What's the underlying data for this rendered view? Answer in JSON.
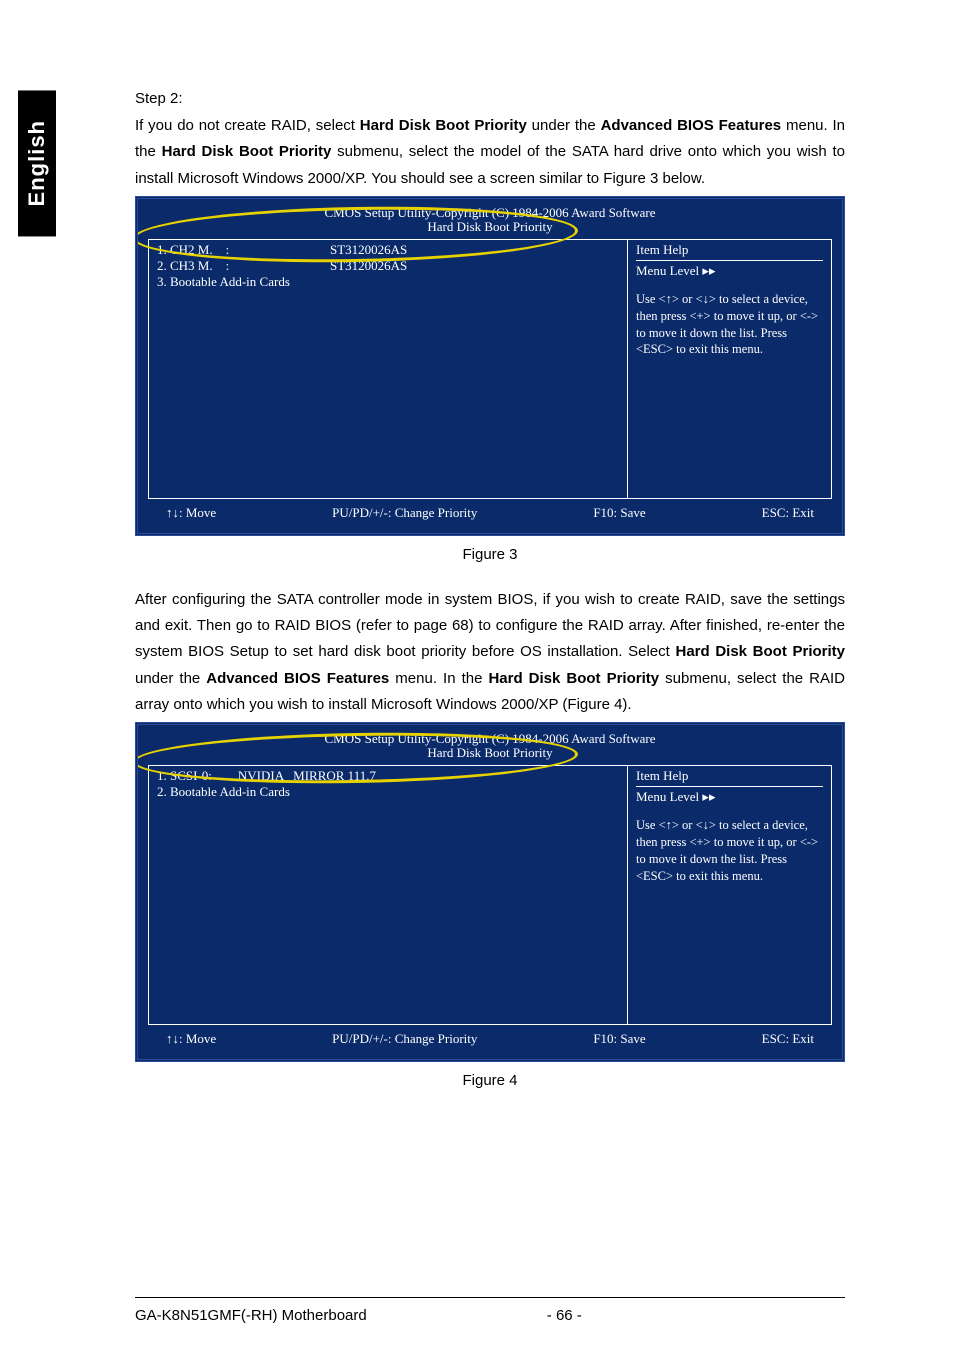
{
  "sideTab": "English",
  "step": "Step 2:",
  "para1": {
    "a": "If you do not create RAID, select ",
    "b": "Hard Disk Boot Priority",
    "c": " under the ",
    "d": "Advanced BIOS Features",
    "e": " menu. In the ",
    "f": "Hard Disk Boot Priority",
    "g": " submenu, select the model of the SATA hard drive onto which you wish to install Microsoft Windows 2000/XP. You should see a screen similar to Figure 3 below."
  },
  "bios_common": {
    "copyright": "CMOS Setup Utility-Copyright (C) 1984-2006 Award Software",
    "subtitle": "Hard Disk Boot Priority",
    "item_help": "Item Help",
    "menu_level": "Menu Level    ▸▸",
    "help_body": "Use <↑>   or <↓> to select a device, then press <+> to move it up, or <-> to move it down the list. Press <ESC> to exit this menu.",
    "footer_move": "↑↓: Move",
    "footer_change": "PU/PD/+/-: Change Priority",
    "footer_save": "F10: Save",
    "footer_exit": "ESC: Exit"
  },
  "bios1": {
    "lines": [
      "1. CH2 M.    :                               ST3120026AS",
      "2. CH3 M.    :                               ST3120026AS",
      "3. Bootable Add-in Cards"
    ]
  },
  "fig3": "Figure 3",
  "para2": {
    "a": "After configuring the SATA controller mode in system BIOS, if you wish to create RAID, save the settings and exit. Then go to RAID BIOS (refer to page 68) to configure the RAID array. After finished, re-enter the system BIOS Setup to set hard disk boot priority before OS installation. Select ",
    "b": "Hard Disk Boot Priority",
    "c": " under the ",
    "d": "Advanced BIOS Features",
    "e": " menu. In the ",
    "f": "Hard Disk Boot Priority",
    "g": " submenu, select the RAID array onto which you wish to install Microsoft Windows 2000/XP (Figure 4)."
  },
  "bios2": {
    "lines": [
      "1. SCSI-0:        NVIDIA   MIRROR 111.7",
      "2. Bootable Add-in Cards"
    ]
  },
  "fig4": "Figure 4",
  "footer_left": "GA-K8N51GMF(-RH) Motherboard",
  "footer_center": "- 66 -"
}
